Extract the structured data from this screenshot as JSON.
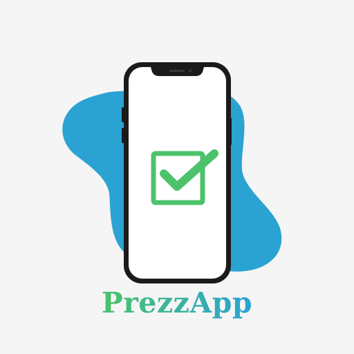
{
  "brand": {
    "name": "PrezzApp",
    "gradient_start": "#4cc26a",
    "gradient_end": "#2aa3d3"
  },
  "colors": {
    "background": "#f5f5f5",
    "blob": "#2aa3d3",
    "phone_frame": "#1b1b1b",
    "screen": "#ffffff",
    "checkbox": "#4cc26a"
  },
  "icons": {
    "logo_graphic": "smartphone-with-checkbox",
    "check": "check-icon"
  }
}
